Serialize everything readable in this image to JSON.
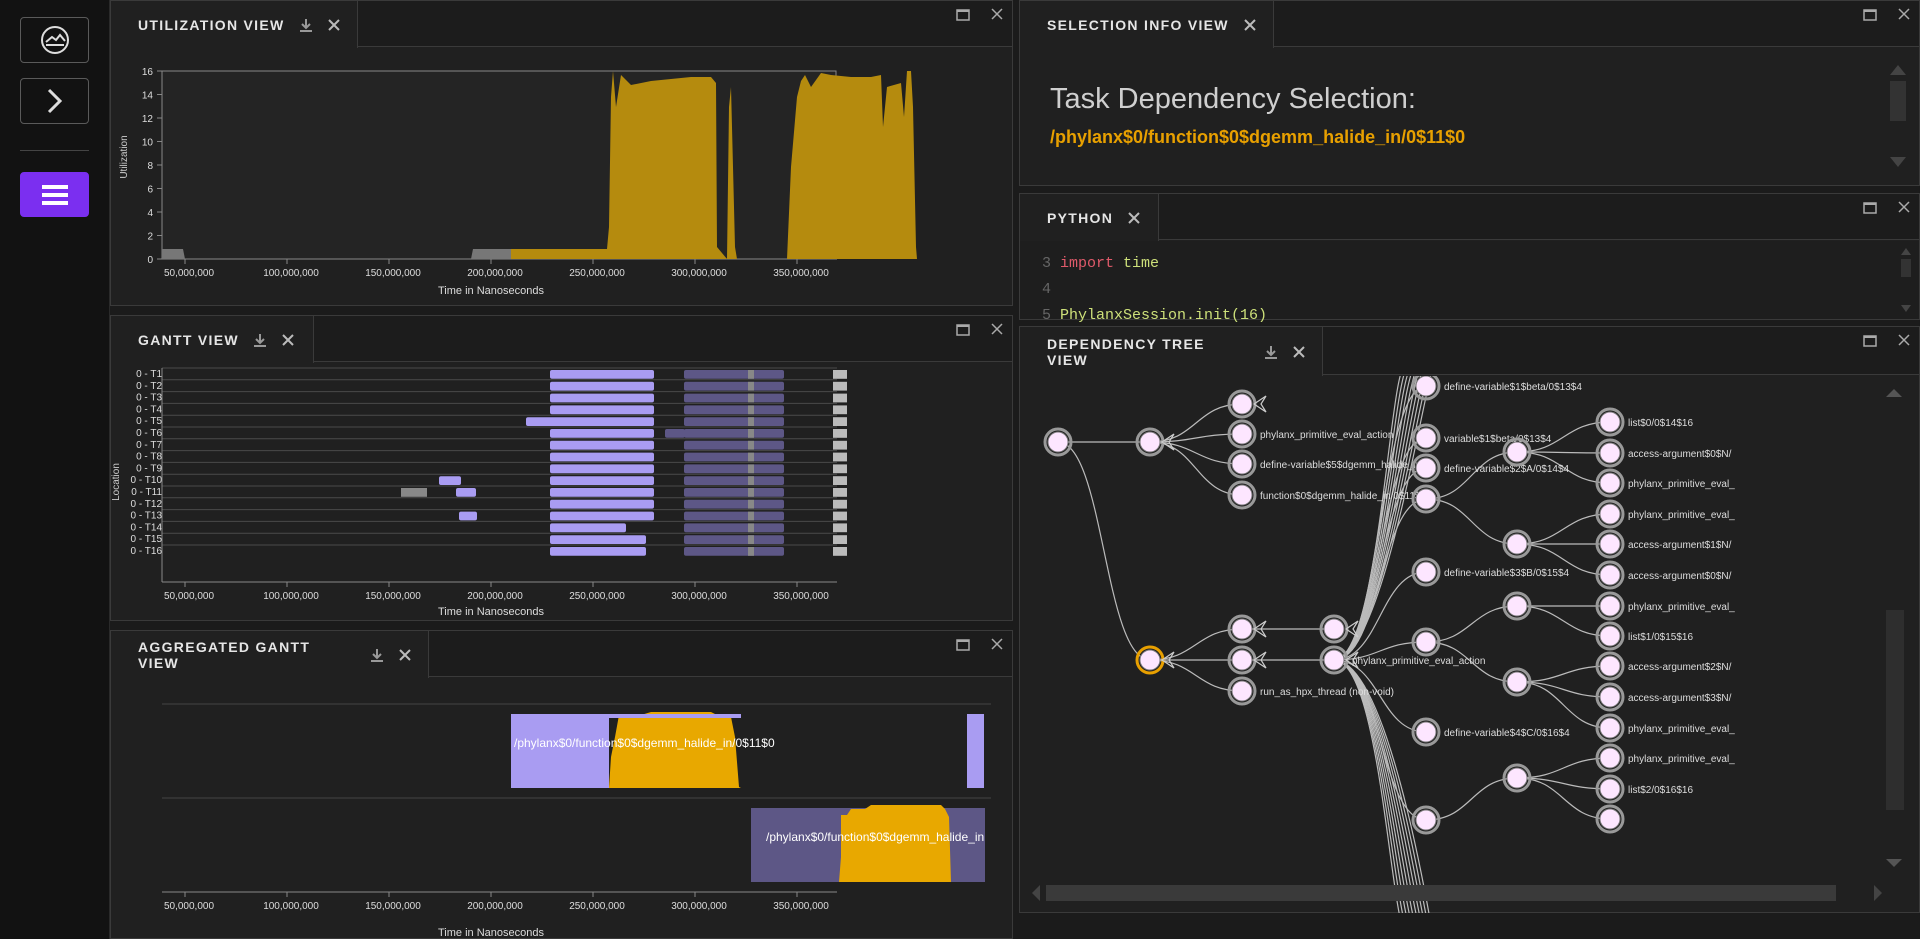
{
  "sidebar": {
    "logo_icon": "app-logo-icon",
    "expand_icon": "chevron-right-icon",
    "menu_icon": "hamburger-menu-icon",
    "accent": "#7b2ff0"
  },
  "utilization": {
    "title": "UTILIZATION VIEW",
    "ylabel": "Utilization",
    "xlabel": "Time in Nanoseconds",
    "yticks": [
      "0",
      "2",
      "4",
      "6",
      "8",
      "10",
      "12",
      "14",
      "16"
    ],
    "xticks": [
      "50,000,000",
      "100,000,000",
      "150,000,000",
      "200,000,000",
      "250,000,000",
      "300,000,000",
      "350,000,000"
    ]
  },
  "gantt": {
    "title": "GANTT VIEW",
    "ylabel": "Location",
    "xlabel": "Time in Nanoseconds",
    "rows": [
      "0 - T1",
      "0 - T2",
      "0 - T3",
      "0 - T4",
      "0 - T5",
      "0 - T6",
      "0 - T7",
      "0 - T8",
      "0 - T9",
      "0 - T10",
      "0 - T11",
      "0 - T12",
      "0 - T13",
      "0 - T14",
      "0 - T15",
      "0 - T16"
    ],
    "xticks": [
      "50,000,000",
      "100,000,000",
      "150,000,000",
      "200,000,000",
      "250,000,000",
      "300,000,000",
      "350,000,000"
    ]
  },
  "aggregated": {
    "title": "AGGREGATED GANTT VIEW",
    "xlabel": "Time in Nanoseconds",
    "label1": "/phylanx$0/function$0$dgemm_halide_in/0$11$0",
    "label2": "/phylanx$0/function$0$dgemm_halide_in",
    "xticks": [
      "50,000,000",
      "100,000,000",
      "150,000,000",
      "200,000,000",
      "250,000,000",
      "300,000,000",
      "350,000,000"
    ]
  },
  "selection": {
    "title": "SELECTION INFO VIEW",
    "heading": "Task Dependency Selection:",
    "selected": "/phylanx$0/function$0$dgemm_halide_in/0$11$0",
    "selected_color": "#e8a000"
  },
  "python": {
    "title": "PYTHON",
    "lines": [
      {
        "num": "3",
        "kw": "import",
        "rest": " time"
      },
      {
        "num": "4",
        "kw": "",
        "rest": ""
      },
      {
        "num": "5",
        "kw": "",
        "rest": "PhylanxSession.init(16)"
      }
    ]
  },
  "tree": {
    "title": "DEPENDENCY TREE VIEW",
    "labels": {
      "a": "phylanx_primitive_eval_action",
      "b": "define-variable$5$dgemm_halide_in/0",
      "c": "function$0$dgemm_halide_in/0$11$0",
      "d": "run_as_hpx_thread (non-void)",
      "e": "phylanx_primitive_eval_action",
      "f": "define-variable$1$beta/0$13$4",
      "g": "variable$1$beta/0$13$4",
      "h": "define-variable$2$A/0$14$4",
      "i": "define-variable$3$B/0$15$4",
      "j": "define-variable$4$C/0$16$4",
      "k": "list$0/0$14$16",
      "l": "access-argument$0$N/",
      "m": "phylanx_primitive_eval_",
      "n": "phylanx_primitive_eval_",
      "o": "access-argument$1$N/",
      "p": "access-argument$0$N/",
      "q": "phylanx_primitive_eval_",
      "r": "list$1/0$15$16",
      "s": "access-argument$2$N/",
      "t": "access-argument$3$N/",
      "u": "phylanx_primitive_eval_",
      "v": "phylanx_primitive_eval_",
      "w": "list$2/0$16$16"
    }
  },
  "colors": {
    "gold": "#b58b0e",
    "gold_bright": "#e8a800",
    "lavender": "#a99cf2",
    "slate": "#5d5786",
    "node": "#fde6ff",
    "highlight": "#e8a000"
  }
}
